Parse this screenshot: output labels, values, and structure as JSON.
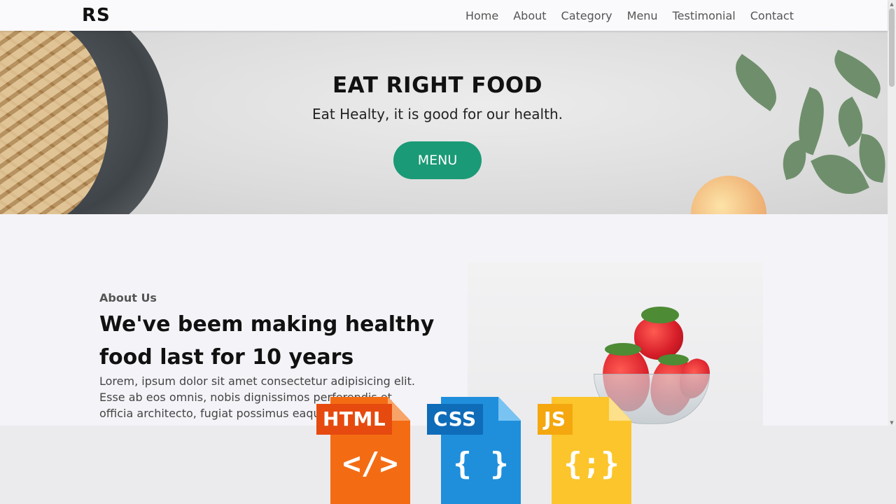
{
  "header": {
    "logo": "RS",
    "nav": [
      "Home",
      "About",
      "Category",
      "Menu",
      "Testimonial",
      "Contact"
    ]
  },
  "hero": {
    "title": "EAT RIGHT FOOD",
    "subtitle": "Eat Healty, it is good for our health.",
    "button_label": "MENU",
    "button_color": "#1a9a76"
  },
  "about": {
    "label": "About Us",
    "heading": "We've beem making healthy food last for 10 years",
    "text": "Lorem, ipsum dolor sit amet consectetur adipisicing elit. Esse ab eos omnis, nobis dignissimos perferendis et officia architecto, fugiat possimus eaque"
  },
  "banner": {
    "files": [
      {
        "tag": "HTML",
        "symbol": "</>",
        "color": "#f36c14",
        "tag_color": "#e64a0f"
      },
      {
        "tag": "CSS",
        "symbol": "{ }",
        "color": "#1f8fdc",
        "tag_color": "#0e6cb9"
      },
      {
        "tag": "JS",
        "symbol": "{;}",
        "color": "#fbc52b",
        "tag_color": "#f4a70f"
      }
    ]
  }
}
